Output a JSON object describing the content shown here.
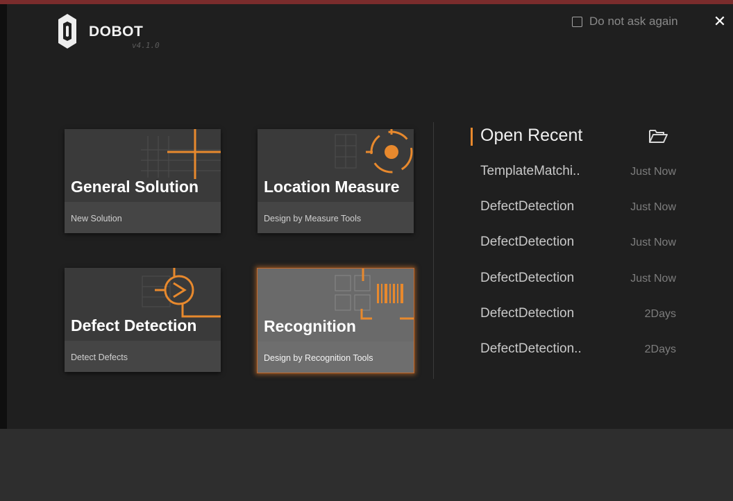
{
  "header": {
    "brand": "DOBOT",
    "version": "v4.1.0",
    "do_not_ask": "Do not ask again",
    "close_glyph": "✕"
  },
  "cards": [
    {
      "title": "General Solution",
      "subtitle": "New Solution",
      "icon": "crosshair-plus-icon"
    },
    {
      "title": "Location Measure",
      "subtitle": "Design by Measure Tools",
      "icon": "target-icon"
    },
    {
      "title": "Defect Detection",
      "subtitle": "Detect Defects",
      "icon": "defect-circle-icon"
    },
    {
      "title": "Recognition",
      "subtitle": "Design by Recognition Tools",
      "icon": "barcode-scan-icon"
    }
  ],
  "recent": {
    "title": "Open Recent",
    "folder_icon": "folder-open-icon",
    "items": [
      {
        "name": "TemplateMatchi..",
        "time": "Just Now"
      },
      {
        "name": "DefectDetection",
        "time": "Just Now"
      },
      {
        "name": "DefectDetection",
        "time": "Just Now"
      },
      {
        "name": "DefectDetection",
        "time": "Just Now"
      },
      {
        "name": "DefectDetection",
        "time": "2Days"
      },
      {
        "name": "DefectDetection..",
        "time": "2Days"
      }
    ]
  },
  "colors": {
    "accent": "#e8892d",
    "background": "#1f1f1f",
    "card": "#3a3a3a",
    "selected_card": "#6a6a6a"
  }
}
